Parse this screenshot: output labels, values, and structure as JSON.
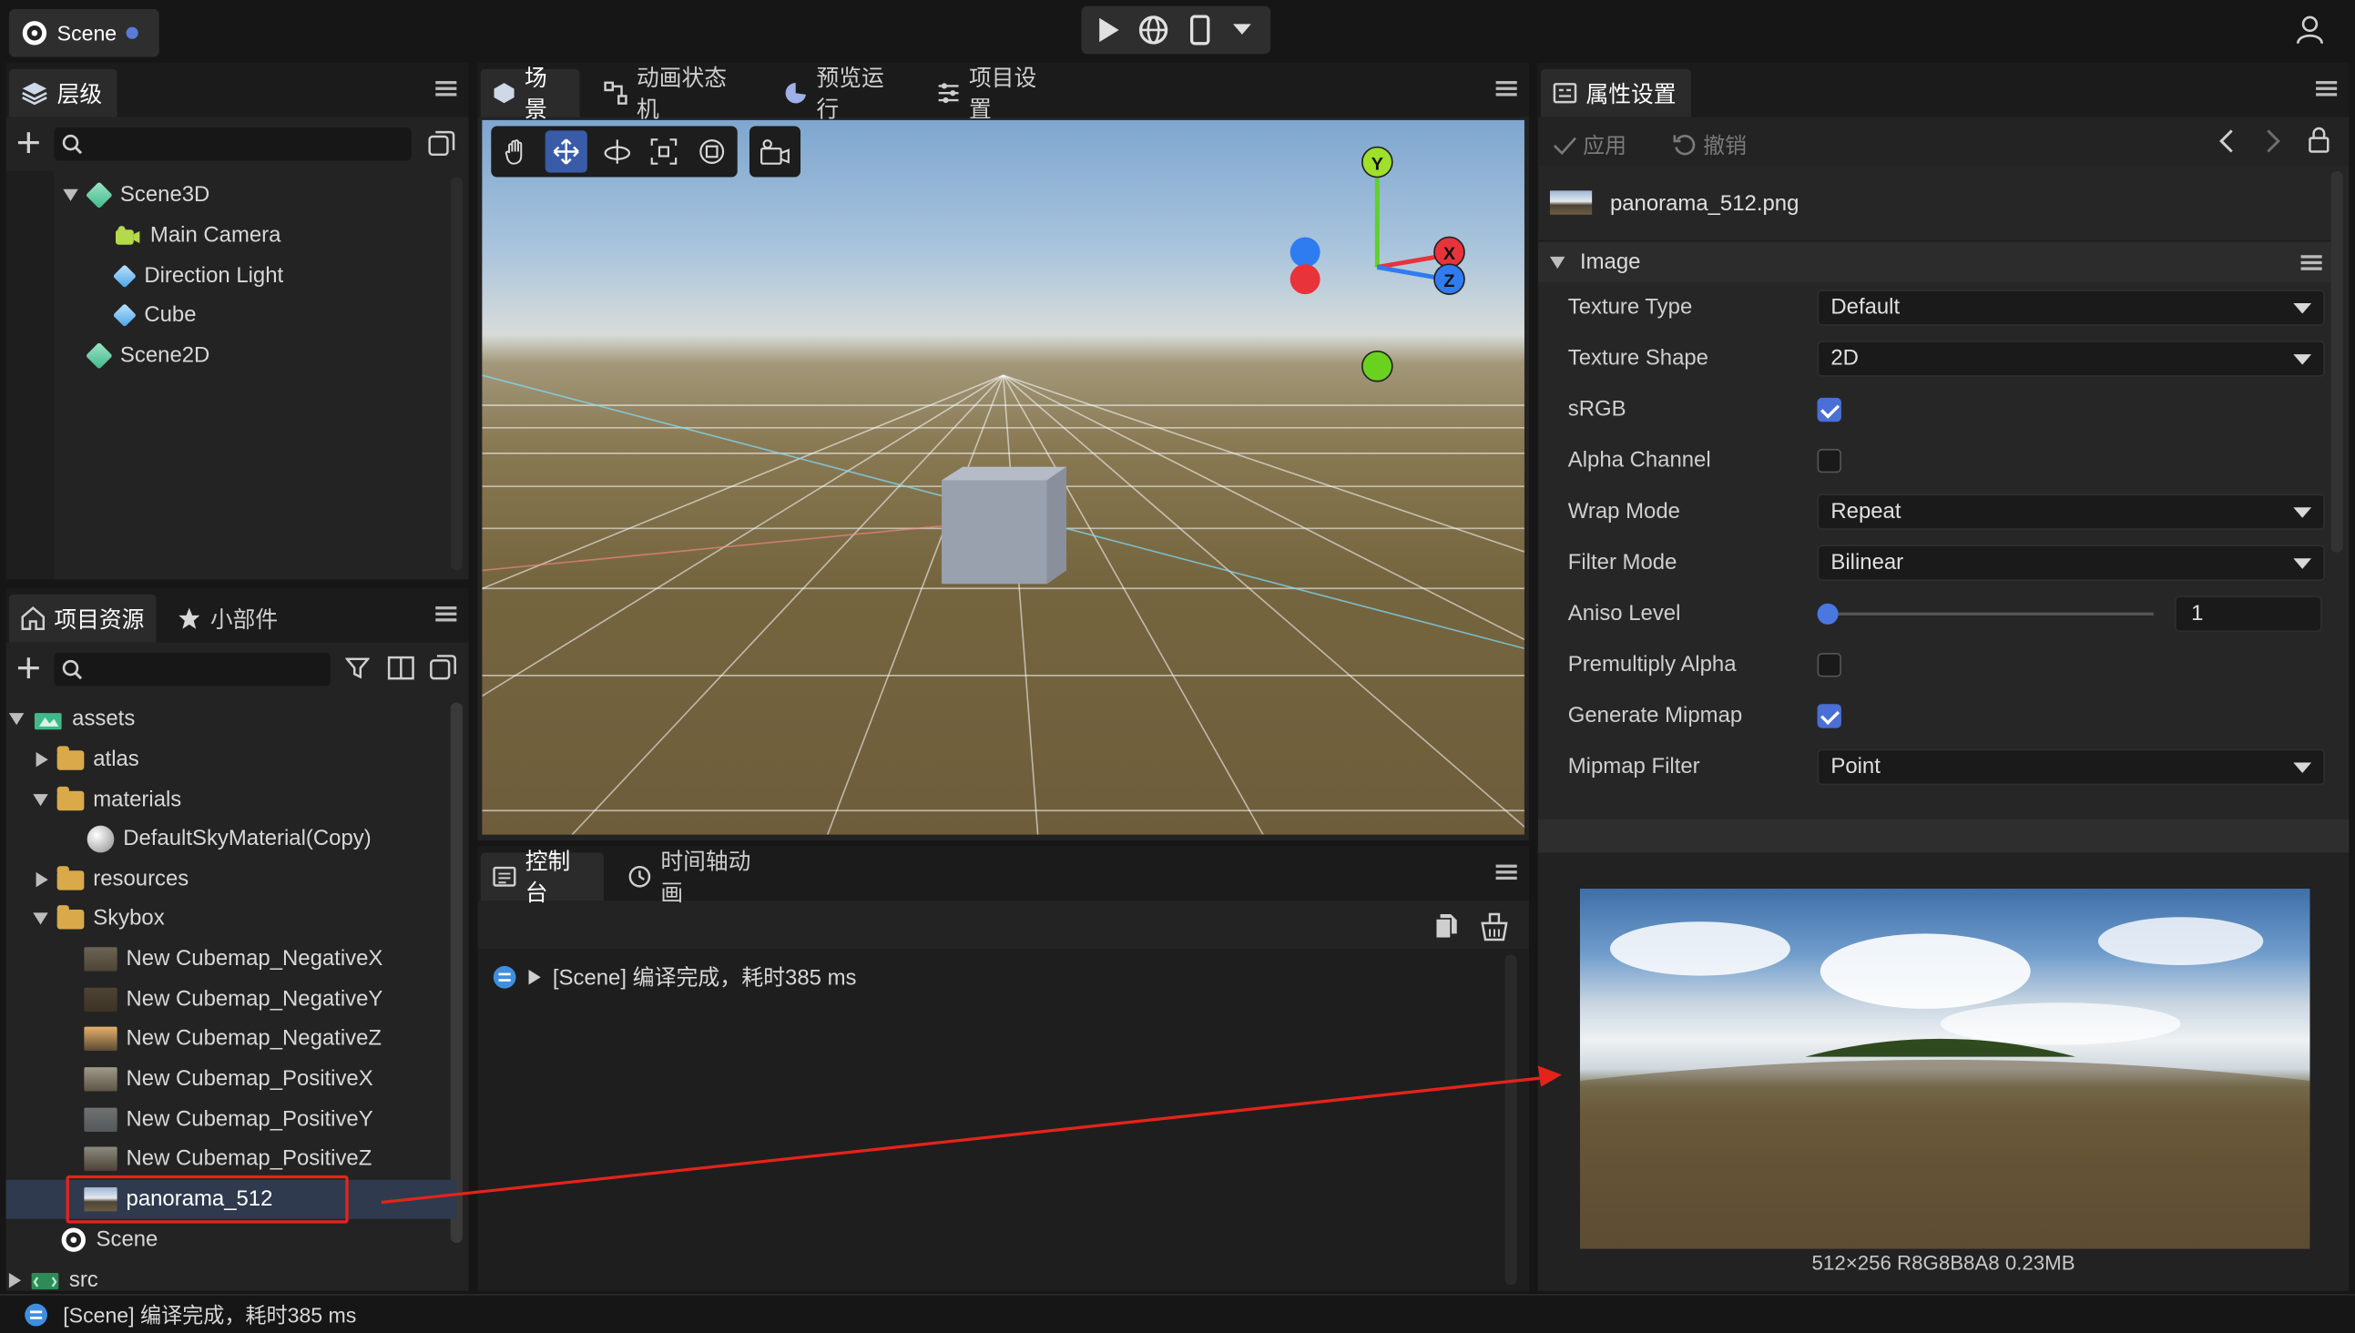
{
  "header": {
    "scene_tab": "Scene"
  },
  "hierarchy": {
    "tab_label": "层级",
    "items": [
      {
        "label": "Scene3D"
      },
      {
        "label": "Main Camera"
      },
      {
        "label": "Direction Light"
      },
      {
        "label": "Cube"
      },
      {
        "label": "Scene2D"
      }
    ]
  },
  "assets_panel": {
    "tabs": [
      "项目资源",
      "小部件"
    ],
    "items": [
      {
        "label": "assets"
      },
      {
        "label": "atlas"
      },
      {
        "label": "materials"
      },
      {
        "label": "DefaultSkyMaterial(Copy)"
      },
      {
        "label": "resources"
      },
      {
        "label": "Skybox"
      },
      {
        "label": "New Cubemap_NegativeX"
      },
      {
        "label": "New Cubemap_NegativeY"
      },
      {
        "label": "New Cubemap_NegativeZ"
      },
      {
        "label": "New Cubemap_PositiveX"
      },
      {
        "label": "New Cubemap_PositiveY"
      },
      {
        "label": "New Cubemap_PositiveZ"
      },
      {
        "label": "panorama_512"
      },
      {
        "label": "Scene"
      },
      {
        "label": "src"
      }
    ]
  },
  "center_tabs": [
    "场景",
    "动画状态机",
    "预览运行",
    "项目设置"
  ],
  "gizmo": {
    "y": "Y",
    "x": "X",
    "z": "Z"
  },
  "console": {
    "tabs": [
      "控制台",
      "时间轴动画"
    ],
    "message": "[Scene] 编译完成，耗时385 ms"
  },
  "inspector": {
    "tab_label": "属性设置",
    "apply_label": "应用",
    "revert_label": "撤销",
    "file_name": "panorama_512.png",
    "section_title": "Image",
    "props": [
      {
        "label": "Texture Type",
        "value": "Default"
      },
      {
        "label": "Texture Shape",
        "value": "2D"
      },
      {
        "label": "sRGB",
        "checked": true
      },
      {
        "label": "Alpha Channel",
        "checked": false
      },
      {
        "label": "Wrap Mode",
        "value": "Repeat"
      },
      {
        "label": "Filter Mode",
        "value": "Bilinear"
      },
      {
        "label": "Aniso Level",
        "value": "1",
        "slider_fraction": 0
      },
      {
        "label": "Premultiply Alpha",
        "checked": false
      },
      {
        "label": "Generate Mipmap",
        "checked": true
      },
      {
        "label": "Mipmap Filter",
        "value": "Point"
      }
    ],
    "preview_caption": "512×256 R8G8B8A8 0.23MB"
  },
  "statusbar": {
    "message": "[Scene] 编译完成，耗时385 ms"
  },
  "colors": {
    "accent": "#4a6fd6",
    "highlight_box": "#e5231b",
    "folder": "#d9a94a"
  }
}
